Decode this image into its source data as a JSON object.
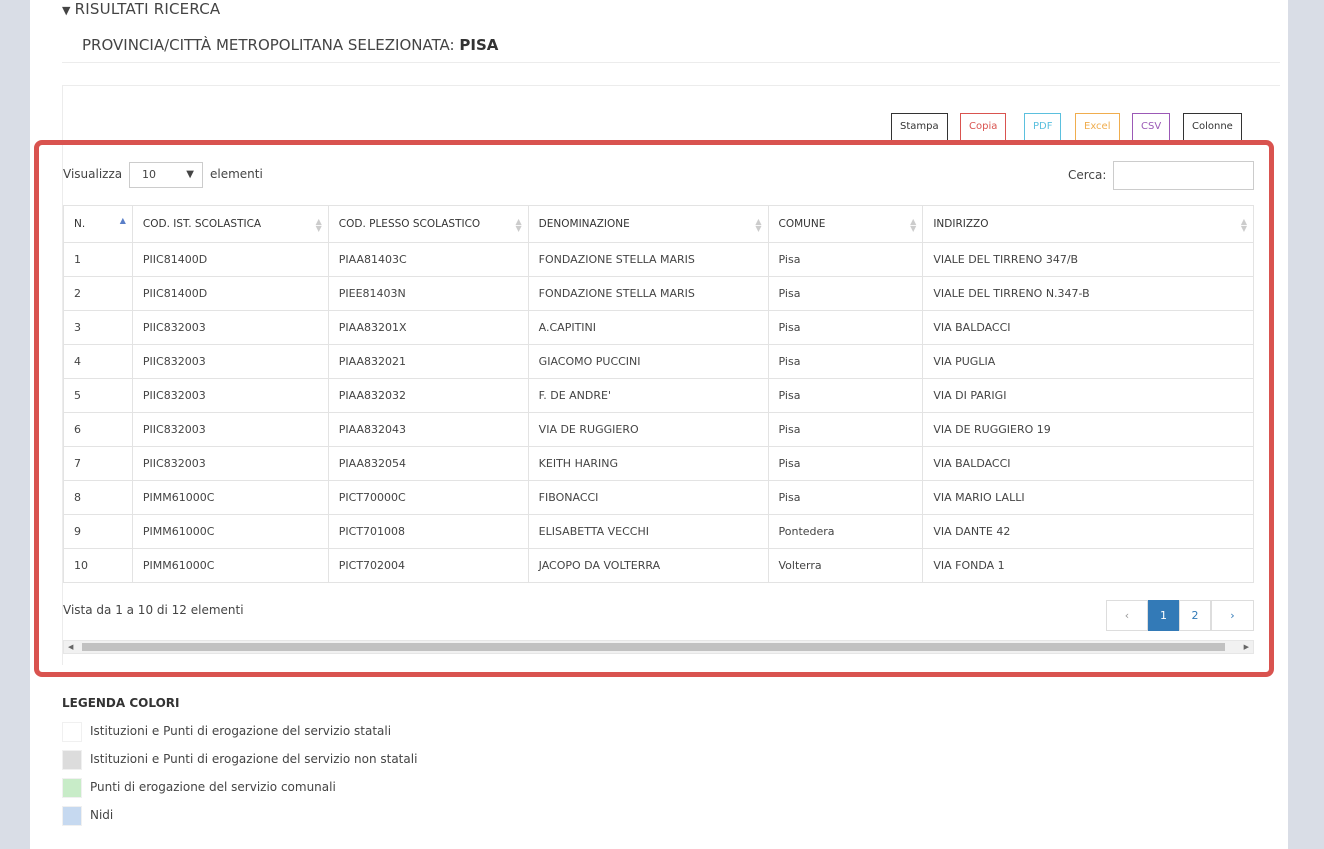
{
  "header": {
    "results_title": "RISULTATI RICERCA",
    "province_label": "PROVINCIA/CITTÀ METROPOLITANA SELEZIONATA:",
    "province_value": "PISA"
  },
  "export_buttons": [
    {
      "label": "Stampa",
      "color": "#333333"
    },
    {
      "label": "Copia",
      "color": "#d9534f"
    },
    {
      "label": "PDF",
      "color": "#5bc0de"
    },
    {
      "label": "Excel",
      "color": "#f0ad4e"
    },
    {
      "label": "CSV",
      "color": "#9b59b6"
    },
    {
      "label": "Colonne",
      "color": "#333333"
    }
  ],
  "controls": {
    "show_label": "Visualizza",
    "show_value": "10",
    "elements_label": "elementi",
    "search_label": "Cerca:",
    "search_value": ""
  },
  "table": {
    "columns": [
      "N.",
      "COD. IST. SCOLASTICA",
      "COD. PLESSO SCOLASTICO",
      "DENOMINAZIONE",
      "COMUNE",
      "INDIRIZZO"
    ],
    "rows": [
      [
        "1",
        "PIIC81400D",
        "PIAA81403C",
        "FONDAZIONE STELLA MARIS",
        "Pisa",
        "VIALE DEL TIRRENO 347/B"
      ],
      [
        "2",
        "PIIC81400D",
        "PIEE81403N",
        "FONDAZIONE STELLA MARIS",
        "Pisa",
        "VIALE DEL TIRRENO N.347-B"
      ],
      [
        "3",
        "PIIC832003",
        "PIAA83201X",
        "A.CAPITINI",
        "Pisa",
        "VIA BALDACCI"
      ],
      [
        "4",
        "PIIC832003",
        "PIAA832021",
        "GIACOMO PUCCINI",
        "Pisa",
        "VIA PUGLIA"
      ],
      [
        "5",
        "PIIC832003",
        "PIAA832032",
        "F. DE ANDRE'",
        "Pisa",
        "VIA DI PARIGI"
      ],
      [
        "6",
        "PIIC832003",
        "PIAA832043",
        "VIA DE RUGGIERO",
        "Pisa",
        "VIA DE RUGGIERO 19"
      ],
      [
        "7",
        "PIIC832003",
        "PIAA832054",
        "KEITH HARING",
        "Pisa",
        "VIA BALDACCI"
      ],
      [
        "8",
        "PIMM61000C",
        "PICT70000C",
        "FIBONACCI",
        "Pisa",
        "VIA MARIO LALLI"
      ],
      [
        "9",
        "PIMM61000C",
        "PICT701008",
        "ELISABETTA VECCHI",
        "Pontedera",
        "VIA DANTE 42"
      ],
      [
        "10",
        "PIMM61000C",
        "PICT702004",
        "JACOPO DA VOLTERRA",
        "Volterra",
        "VIA FONDA 1"
      ]
    ]
  },
  "footer": {
    "info": "Vista da 1 a 10 di 12 elementi",
    "pages": [
      {
        "label": "‹",
        "active": false
      },
      {
        "label": "1",
        "active": true
      },
      {
        "label": "2",
        "active": false
      },
      {
        "label": "›",
        "active": false
      }
    ]
  },
  "legend": {
    "title": "LEGENDA COLORI",
    "items": [
      {
        "label": "Istituzioni e Punti di erogazione del servizio statali",
        "color": "#ffffff"
      },
      {
        "label": "Istituzioni e Punti di erogazione del servizio non statali",
        "color": "#dcdcdc"
      },
      {
        "label": "Punti di erogazione del servizio comunali",
        "color": "#c8ecc8"
      },
      {
        "label": "Nidi",
        "color": "#c6d9f0"
      }
    ]
  }
}
